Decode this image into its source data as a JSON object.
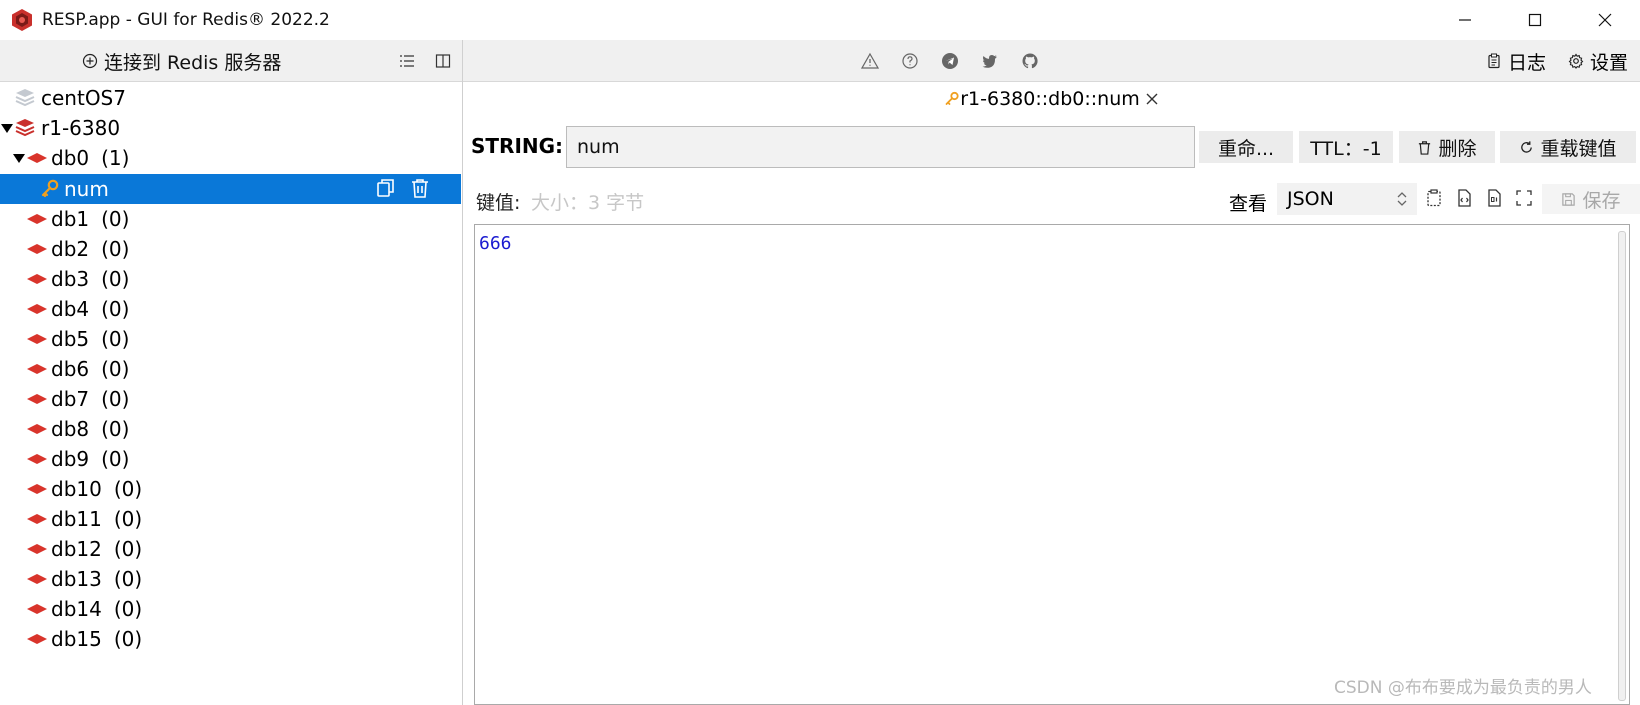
{
  "window": {
    "title": "RESP.app - GUI for Redis® 2022.2"
  },
  "toolbar": {
    "connect_label": "连接到 Redis 服务器",
    "log_label": "日志",
    "settings_label": "设置"
  },
  "tree": {
    "connections": [
      {
        "name": "centOS7"
      },
      {
        "name": "r1-6380"
      }
    ],
    "databases": [
      {
        "name": "db0",
        "count": "(1)"
      },
      {
        "name": "db1",
        "count": "(0)"
      },
      {
        "name": "db2",
        "count": "(0)"
      },
      {
        "name": "db3",
        "count": "(0)"
      },
      {
        "name": "db4",
        "count": "(0)"
      },
      {
        "name": "db5",
        "count": "(0)"
      },
      {
        "name": "db6",
        "count": "(0)"
      },
      {
        "name": "db7",
        "count": "(0)"
      },
      {
        "name": "db8",
        "count": "(0)"
      },
      {
        "name": "db9",
        "count": "(0)"
      },
      {
        "name": "db10",
        "count": "(0)"
      },
      {
        "name": "db11",
        "count": "(0)"
      },
      {
        "name": "db12",
        "count": "(0)"
      },
      {
        "name": "db13",
        "count": "(0)"
      },
      {
        "name": "db14",
        "count": "(0)"
      },
      {
        "name": "db15",
        "count": "(0)"
      }
    ],
    "selected_key": "num"
  },
  "tab": {
    "title": "r1-6380::db0::num"
  },
  "key_editor": {
    "type_label": "STRING:",
    "key_name": "num",
    "rename_label": "重命...",
    "ttl_label": "TTL：-1",
    "delete_label": "删除",
    "reload_label": "重载键值"
  },
  "value": {
    "label": "键值:",
    "size_label": "大小：3 字节",
    "view_label": "查看",
    "view_mode": "JSON",
    "save_label": "保存",
    "content": "666"
  },
  "watermark": "CSDN @布布要成为最负责的男人",
  "colors": {
    "selection": "#0a78d8",
    "redis_red": "#d9342b",
    "key_orange": "#f0a020",
    "value_blue": "#1a1ad0"
  }
}
